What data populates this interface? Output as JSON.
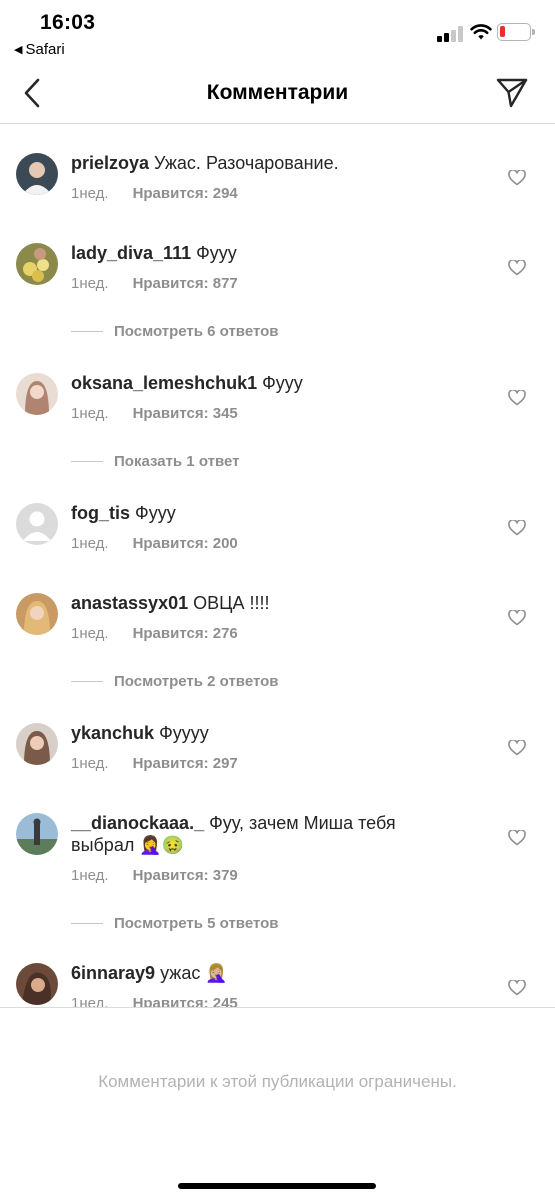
{
  "status_bar": {
    "time": "16:03",
    "back_app": "Safari",
    "battery_color": "#e3312d"
  },
  "header": {
    "title": "Комментарии"
  },
  "comments": [
    {
      "username": "prielzoya",
      "text": "Ужас. Разочарование.",
      "time": "1нед.",
      "likes": "Нравится: 294",
      "avatar_color": "#3c4a55"
    },
    {
      "username": "lady_diva_111",
      "text": "Фууу",
      "time": "1нед.",
      "likes": "Нравится: 877",
      "avatar_color": "#8c8a4a",
      "replies": "Посмотреть 6 ответов"
    },
    {
      "username": "oksana_lemeshchuk1",
      "text": "Фууу",
      "time": "1нед.",
      "likes": "Нравится: 345",
      "avatar_color": "#d9c3b5",
      "replies": "Показать 1 ответ"
    },
    {
      "username": "fog_tis",
      "text": "Фууу",
      "time": "1нед.",
      "likes": "Нравится: 200",
      "avatar_color": "#dbdbdb"
    },
    {
      "username": "anastassyx01",
      "text": "ОВЦА !!!!",
      "time": "1нед.",
      "likes": "Нравится: 276",
      "avatar_color": "#c99a63",
      "replies": "Посмотреть 2 ответов"
    },
    {
      "username": "ykanchuk",
      "text": "Фуууу",
      "time": "1нед.",
      "likes": "Нравится: 297",
      "avatar_color": "#7a5a48"
    },
    {
      "username": "__dianockaaa._",
      "text": "Фуу, зачем Миша тебя выбрал 🤦‍♀️🤢",
      "time": "1нед.",
      "likes": "Нравится: 379",
      "avatar_color": "#5d7d5a",
      "replies": "Посмотреть 5 ответов"
    },
    {
      "username": "6innaray9",
      "text": "ужас 🤦🏼‍♀️",
      "time": "1нед.",
      "likes": "Нравится: 245",
      "avatar_color": "#6b4a3a"
    }
  ],
  "footer": {
    "message": "Комментарии к этой публикации ограничены."
  }
}
